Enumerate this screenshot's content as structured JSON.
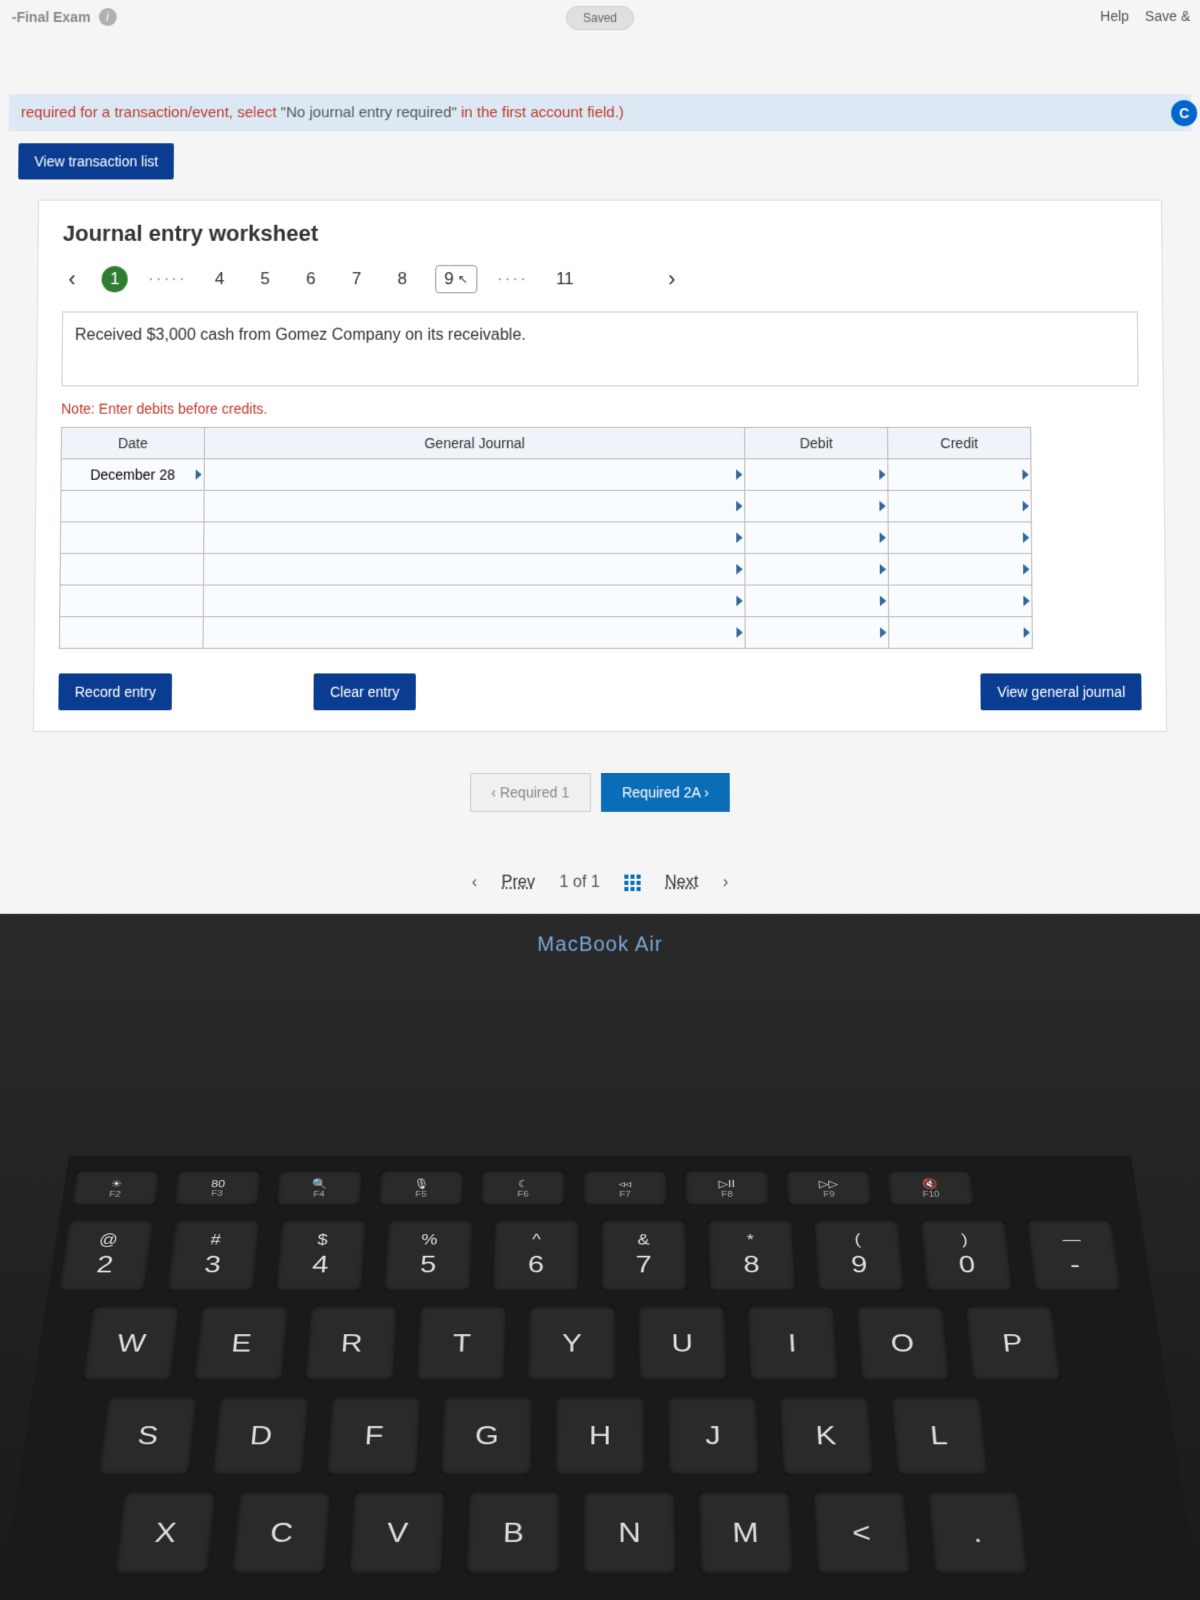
{
  "top": {
    "exam_label": "-Final Exam",
    "saved": "Saved",
    "help": "Help",
    "save_exit": "Save &"
  },
  "instruction": {
    "text_prefix": "required for a transaction/event, select ",
    "quoted": "\"No journal entry required\"",
    "text_suffix": " in the first account field.)",
    "badge": "C"
  },
  "buttons": {
    "view_transaction_list": "View transaction list",
    "record_entry": "Record entry",
    "clear_entry": "Clear entry",
    "view_general_journal": "View general journal"
  },
  "worksheet": {
    "title": "Journal entry worksheet",
    "pager_active": "1",
    "pager_items": [
      "4",
      "5",
      "6",
      "7",
      "8"
    ],
    "pager_boxed": "9",
    "pager_after": "11",
    "description": "Received $3,000 cash from Gomez Company on its receivable.",
    "note": "Note: Enter debits before credits."
  },
  "table": {
    "headers": {
      "date": "Date",
      "gj": "General Journal",
      "debit": "Debit",
      "credit": "Credit"
    },
    "date_value": "December 28",
    "rows": 6
  },
  "req_nav": {
    "prev": "‹   Required 1",
    "next": "Required 2A   ›"
  },
  "bottom_nav": {
    "prev": "Prev",
    "position": "1 of 1",
    "next": "Next"
  },
  "macbook": "MacBook Air",
  "keyboard": {
    "fnrow": [
      {
        "icon": "☀",
        "label": "F2"
      },
      {
        "icon": "▦",
        "label": "F3",
        "top": "80"
      },
      {
        "icon": "🔍",
        "label": "F4"
      },
      {
        "icon": "🎙",
        "label": "F5"
      },
      {
        "icon": "☾",
        "label": "F6"
      },
      {
        "icon": "◃◃",
        "label": "F7"
      },
      {
        "icon": "▷II",
        "label": "F8"
      },
      {
        "icon": "▷▷",
        "label": "F9"
      },
      {
        "icon": "🔇",
        "label": "F10"
      }
    ],
    "row1": [
      {
        "t": "@",
        "b": "2"
      },
      {
        "t": "#",
        "b": "3"
      },
      {
        "t": "$",
        "b": "4"
      },
      {
        "t": "%",
        "b": "5"
      },
      {
        "t": "^",
        "b": "6"
      },
      {
        "t": "&",
        "b": "7"
      },
      {
        "t": "*",
        "b": "8"
      },
      {
        "t": "(",
        "b": "9"
      },
      {
        "t": ")",
        "b": "0"
      },
      {
        "t": "—",
        "b": "-"
      }
    ],
    "row2": [
      "W",
      "E",
      "R",
      "T",
      "Y",
      "U",
      "I",
      "O",
      "P"
    ],
    "row3": [
      "S",
      "D",
      "F",
      "G",
      "H",
      "J",
      "K",
      "L"
    ],
    "row4": [
      "X",
      "C",
      "V",
      "B",
      "N",
      "M",
      "<",
      "."
    ]
  }
}
